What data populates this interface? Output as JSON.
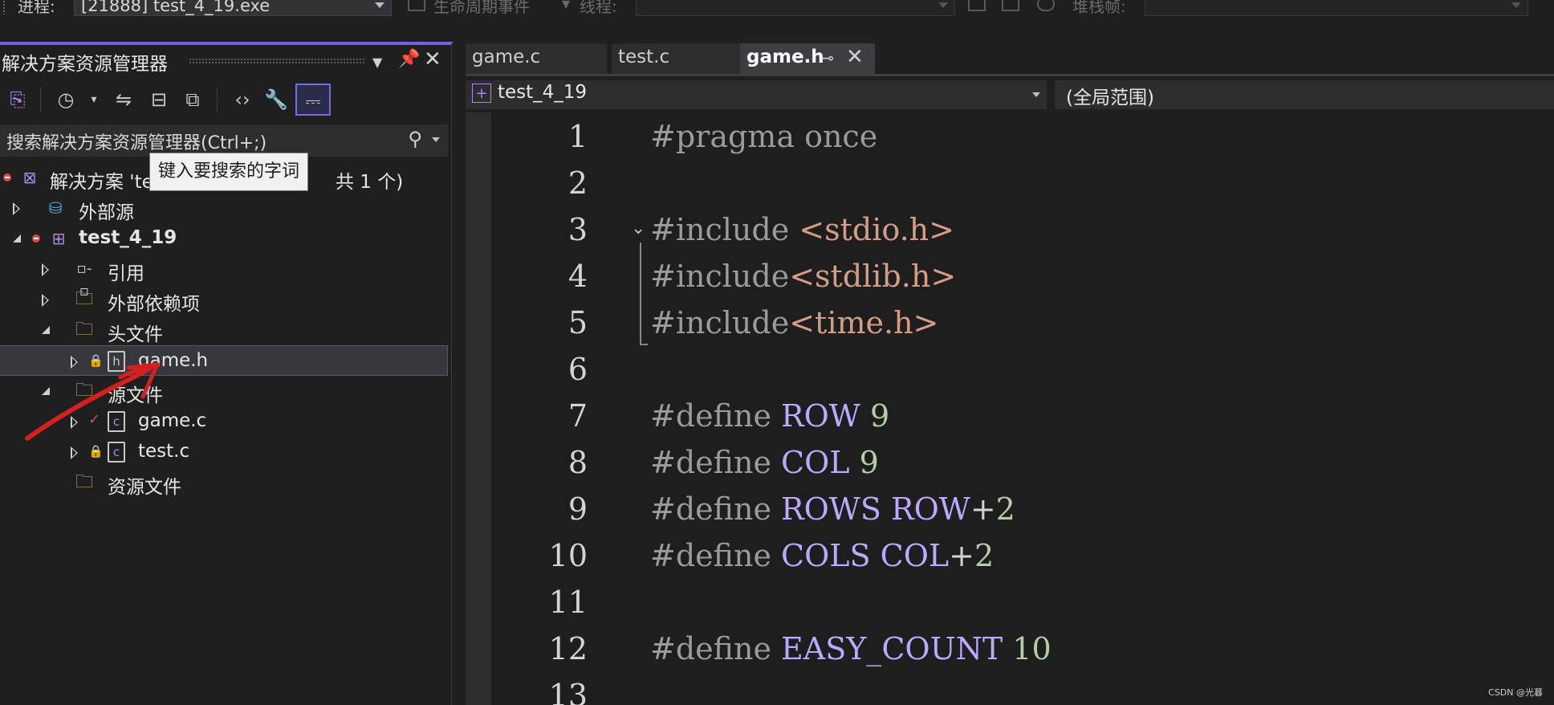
{
  "toolbar": {
    "process_label": "进程:",
    "process_value": "[21888] test_4_19.exe",
    "lifecycle_label": "生命周期事件",
    "thread_label": "线程:",
    "stack_label": "堆栈帧:"
  },
  "solution_explorer": {
    "title": "解决方案资源管理器",
    "search_placeholder": "搜索解决方案资源管理器(Ctrl+;)",
    "tooltip": "键入要搜索的字词",
    "tree": {
      "solution_prefix": "解决方案 'te",
      "solution_suffix": "共 1 个)",
      "external_sources": "外部源",
      "project": "test_4_19",
      "references": "引用",
      "external_deps": "外部依赖项",
      "header_files": "头文件",
      "game_h": "game.h",
      "source_files": "源文件",
      "game_c": "game.c",
      "test_c": "test.c",
      "resource_files": "资源文件"
    }
  },
  "editor": {
    "tabs": [
      {
        "label": "game.c"
      },
      {
        "label": "test.c"
      },
      {
        "label": "game.h"
      }
    ],
    "project_scope": "test_4_19",
    "global_scope": "(全局范围)",
    "lines": [
      {
        "n": "1",
        "tokens": [
          {
            "t": "#pragma once",
            "c": "c-pre"
          }
        ]
      },
      {
        "n": "2",
        "tokens": []
      },
      {
        "n": "3",
        "tokens": [
          {
            "t": "#include ",
            "c": "c-pre"
          },
          {
            "t": "<stdio.h>",
            "c": "c-str"
          }
        ]
      },
      {
        "n": "4",
        "tokens": [
          {
            "t": "#include",
            "c": "c-pre"
          },
          {
            "t": "<stdlib.h>",
            "c": "c-str"
          }
        ]
      },
      {
        "n": "5",
        "tokens": [
          {
            "t": "#include",
            "c": "c-pre"
          },
          {
            "t": "<time.h>",
            "c": "c-str"
          }
        ]
      },
      {
        "n": "6",
        "tokens": []
      },
      {
        "n": "7",
        "tokens": [
          {
            "t": "#define ",
            "c": "c-pre"
          },
          {
            "t": "ROW",
            "c": "c-mac"
          },
          {
            "t": " ",
            "c": "c-plain"
          },
          {
            "t": "9",
            "c": "c-num"
          }
        ]
      },
      {
        "n": "8",
        "tokens": [
          {
            "t": "#define ",
            "c": "c-pre"
          },
          {
            "t": "COL",
            "c": "c-mac"
          },
          {
            "t": " ",
            "c": "c-plain"
          },
          {
            "t": "9",
            "c": "c-num"
          }
        ]
      },
      {
        "n": "9",
        "tokens": [
          {
            "t": "#define ",
            "c": "c-pre"
          },
          {
            "t": "ROWS",
            "c": "c-mac"
          },
          {
            "t": " ",
            "c": "c-plain"
          },
          {
            "t": "ROW",
            "c": "c-mac"
          },
          {
            "t": "+",
            "c": "c-plain"
          },
          {
            "t": "2",
            "c": "c-num"
          }
        ]
      },
      {
        "n": "10",
        "tokens": [
          {
            "t": "#define ",
            "c": "c-pre"
          },
          {
            "t": "COLS",
            "c": "c-mac"
          },
          {
            "t": " ",
            "c": "c-plain"
          },
          {
            "t": "COL",
            "c": "c-mac"
          },
          {
            "t": "+",
            "c": "c-plain"
          },
          {
            "t": "2",
            "c": "c-num"
          }
        ]
      },
      {
        "n": "11",
        "tokens": []
      },
      {
        "n": "12",
        "tokens": [
          {
            "t": "#define ",
            "c": "c-pre"
          },
          {
            "t": "EASY_COUNT",
            "c": "c-mac"
          },
          {
            "t": " ",
            "c": "c-plain"
          },
          {
            "t": "10",
            "c": "c-num"
          }
        ]
      },
      {
        "n": "13",
        "tokens": []
      }
    ]
  },
  "watermark": "CSDN @光暮"
}
